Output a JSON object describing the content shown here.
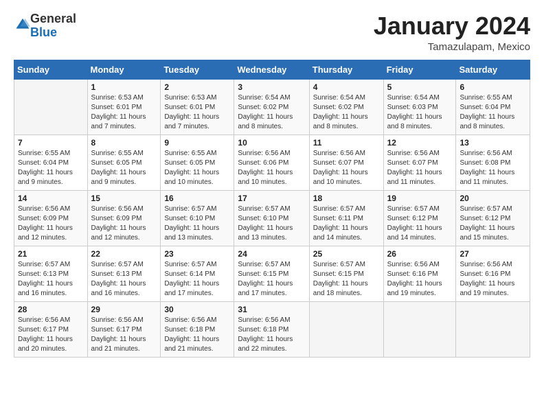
{
  "header": {
    "logo_general": "General",
    "logo_blue": "Blue",
    "month_title": "January 2024",
    "location": "Tamazulapam, Mexico"
  },
  "days_of_week": [
    "Sunday",
    "Monday",
    "Tuesday",
    "Wednesday",
    "Thursday",
    "Friday",
    "Saturday"
  ],
  "weeks": [
    [
      {
        "day": "",
        "sunrise": "",
        "sunset": "",
        "daylight": ""
      },
      {
        "day": "1",
        "sunrise": "Sunrise: 6:53 AM",
        "sunset": "Sunset: 6:01 PM",
        "daylight": "Daylight: 11 hours and 7 minutes."
      },
      {
        "day": "2",
        "sunrise": "Sunrise: 6:53 AM",
        "sunset": "Sunset: 6:01 PM",
        "daylight": "Daylight: 11 hours and 7 minutes."
      },
      {
        "day": "3",
        "sunrise": "Sunrise: 6:54 AM",
        "sunset": "Sunset: 6:02 PM",
        "daylight": "Daylight: 11 hours and 8 minutes."
      },
      {
        "day": "4",
        "sunrise": "Sunrise: 6:54 AM",
        "sunset": "Sunset: 6:02 PM",
        "daylight": "Daylight: 11 hours and 8 minutes."
      },
      {
        "day": "5",
        "sunrise": "Sunrise: 6:54 AM",
        "sunset": "Sunset: 6:03 PM",
        "daylight": "Daylight: 11 hours and 8 minutes."
      },
      {
        "day": "6",
        "sunrise": "Sunrise: 6:55 AM",
        "sunset": "Sunset: 6:04 PM",
        "daylight": "Daylight: 11 hours and 8 minutes."
      }
    ],
    [
      {
        "day": "7",
        "sunrise": "Sunrise: 6:55 AM",
        "sunset": "Sunset: 6:04 PM",
        "daylight": "Daylight: 11 hours and 9 minutes."
      },
      {
        "day": "8",
        "sunrise": "Sunrise: 6:55 AM",
        "sunset": "Sunset: 6:05 PM",
        "daylight": "Daylight: 11 hours and 9 minutes."
      },
      {
        "day": "9",
        "sunrise": "Sunrise: 6:55 AM",
        "sunset": "Sunset: 6:05 PM",
        "daylight": "Daylight: 11 hours and 10 minutes."
      },
      {
        "day": "10",
        "sunrise": "Sunrise: 6:56 AM",
        "sunset": "Sunset: 6:06 PM",
        "daylight": "Daylight: 11 hours and 10 minutes."
      },
      {
        "day": "11",
        "sunrise": "Sunrise: 6:56 AM",
        "sunset": "Sunset: 6:07 PM",
        "daylight": "Daylight: 11 hours and 10 minutes."
      },
      {
        "day": "12",
        "sunrise": "Sunrise: 6:56 AM",
        "sunset": "Sunset: 6:07 PM",
        "daylight": "Daylight: 11 hours and 11 minutes."
      },
      {
        "day": "13",
        "sunrise": "Sunrise: 6:56 AM",
        "sunset": "Sunset: 6:08 PM",
        "daylight": "Daylight: 11 hours and 11 minutes."
      }
    ],
    [
      {
        "day": "14",
        "sunrise": "Sunrise: 6:56 AM",
        "sunset": "Sunset: 6:09 PM",
        "daylight": "Daylight: 11 hours and 12 minutes."
      },
      {
        "day": "15",
        "sunrise": "Sunrise: 6:56 AM",
        "sunset": "Sunset: 6:09 PM",
        "daylight": "Daylight: 11 hours and 12 minutes."
      },
      {
        "day": "16",
        "sunrise": "Sunrise: 6:57 AM",
        "sunset": "Sunset: 6:10 PM",
        "daylight": "Daylight: 11 hours and 13 minutes."
      },
      {
        "day": "17",
        "sunrise": "Sunrise: 6:57 AM",
        "sunset": "Sunset: 6:10 PM",
        "daylight": "Daylight: 11 hours and 13 minutes."
      },
      {
        "day": "18",
        "sunrise": "Sunrise: 6:57 AM",
        "sunset": "Sunset: 6:11 PM",
        "daylight": "Daylight: 11 hours and 14 minutes."
      },
      {
        "day": "19",
        "sunrise": "Sunrise: 6:57 AM",
        "sunset": "Sunset: 6:12 PM",
        "daylight": "Daylight: 11 hours and 14 minutes."
      },
      {
        "day": "20",
        "sunrise": "Sunrise: 6:57 AM",
        "sunset": "Sunset: 6:12 PM",
        "daylight": "Daylight: 11 hours and 15 minutes."
      }
    ],
    [
      {
        "day": "21",
        "sunrise": "Sunrise: 6:57 AM",
        "sunset": "Sunset: 6:13 PM",
        "daylight": "Daylight: 11 hours and 16 minutes."
      },
      {
        "day": "22",
        "sunrise": "Sunrise: 6:57 AM",
        "sunset": "Sunset: 6:13 PM",
        "daylight": "Daylight: 11 hours and 16 minutes."
      },
      {
        "day": "23",
        "sunrise": "Sunrise: 6:57 AM",
        "sunset": "Sunset: 6:14 PM",
        "daylight": "Daylight: 11 hours and 17 minutes."
      },
      {
        "day": "24",
        "sunrise": "Sunrise: 6:57 AM",
        "sunset": "Sunset: 6:15 PM",
        "daylight": "Daylight: 11 hours and 17 minutes."
      },
      {
        "day": "25",
        "sunrise": "Sunrise: 6:57 AM",
        "sunset": "Sunset: 6:15 PM",
        "daylight": "Daylight: 11 hours and 18 minutes."
      },
      {
        "day": "26",
        "sunrise": "Sunrise: 6:56 AM",
        "sunset": "Sunset: 6:16 PM",
        "daylight": "Daylight: 11 hours and 19 minutes."
      },
      {
        "day": "27",
        "sunrise": "Sunrise: 6:56 AM",
        "sunset": "Sunset: 6:16 PM",
        "daylight": "Daylight: 11 hours and 19 minutes."
      }
    ],
    [
      {
        "day": "28",
        "sunrise": "Sunrise: 6:56 AM",
        "sunset": "Sunset: 6:17 PM",
        "daylight": "Daylight: 11 hours and 20 minutes."
      },
      {
        "day": "29",
        "sunrise": "Sunrise: 6:56 AM",
        "sunset": "Sunset: 6:17 PM",
        "daylight": "Daylight: 11 hours and 21 minutes."
      },
      {
        "day": "30",
        "sunrise": "Sunrise: 6:56 AM",
        "sunset": "Sunset: 6:18 PM",
        "daylight": "Daylight: 11 hours and 21 minutes."
      },
      {
        "day": "31",
        "sunrise": "Sunrise: 6:56 AM",
        "sunset": "Sunset: 6:18 PM",
        "daylight": "Daylight: 11 hours and 22 minutes."
      },
      {
        "day": "",
        "sunrise": "",
        "sunset": "",
        "daylight": ""
      },
      {
        "day": "",
        "sunrise": "",
        "sunset": "",
        "daylight": ""
      },
      {
        "day": "",
        "sunrise": "",
        "sunset": "",
        "daylight": ""
      }
    ]
  ]
}
